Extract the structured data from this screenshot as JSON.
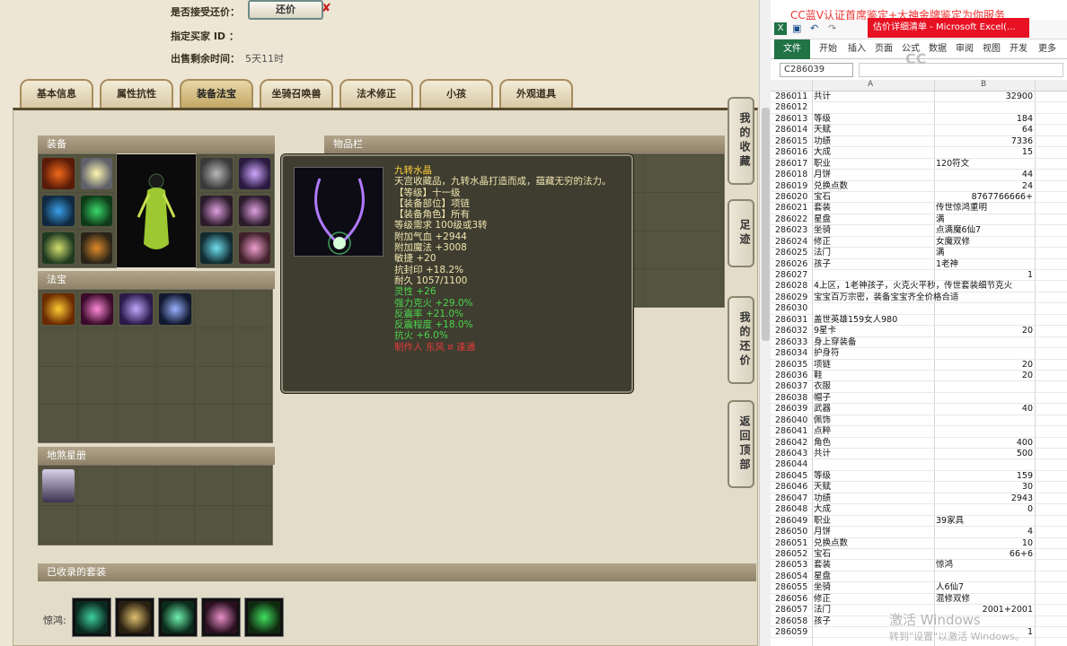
{
  "header": {
    "accept_counter_label": "是否接受还价：",
    "counter_button": "还价",
    "buyer_label": "指定买家 ID ：",
    "buyer_value": "",
    "time_label": "出售剩余时间：",
    "time_value": "5天11时"
  },
  "tabs": [
    "基本信息",
    "属性抗性",
    "装备法宝",
    "坐骑召唤兽",
    "法术修正",
    "小孩",
    "外观道具"
  ],
  "active_tab": "装备法宝",
  "sections": {
    "equipment": "装备",
    "inventory": "物品栏",
    "treasure": "法宝",
    "star_map": "地煞星册",
    "collected_sets": "已收录的套装"
  },
  "set_label": "惊鸿:",
  "tooltip": {
    "name": "九转水晶",
    "desc": "天宫收藏品，九转水晶打造而成，蕴藏无穷的法力。",
    "lines": [
      {
        "text": "【等级】十一级",
        "color": "#f0e6b0"
      },
      {
        "text": "【装备部位】项链",
        "color": "#f0e6b0"
      },
      {
        "text": "【装备角色】所有",
        "color": "#f0e6b0"
      },
      {
        "text": "等级需求 100级或3转",
        "color": "#f0e6b0"
      },
      {
        "text": "附加气血 +2944",
        "color": "#f0e6b0"
      },
      {
        "text": "附加魔法 +3008",
        "color": "#f0e6b0"
      },
      {
        "text": "敏捷 +20",
        "color": "#f0e6b0"
      },
      {
        "text": "抗封印 +18.2%",
        "color": "#f0e6b0"
      },
      {
        "text": "耐久 1057/1100",
        "color": "#f0e6b0"
      },
      {
        "text": "灵性 +26",
        "color": "#4cd64c"
      },
      {
        "text": "强力克火 +29.0%",
        "color": "#4cd64c"
      },
      {
        "text": "反震率 +21.0%",
        "color": "#4cd64c"
      },
      {
        "text": "反震程度 +18.0%",
        "color": "#4cd64c"
      },
      {
        "text": "抗火 +6.0%",
        "color": "#4cd64c"
      },
      {
        "text": "制作人 东风 ¤ 逢通",
        "color": "#e23a3a"
      }
    ]
  },
  "side_buttons": [
    "我的收藏",
    "足迹",
    "我的还价",
    "返回顶部"
  ],
  "excel": {
    "ad_text": "CC蓝V认证首席鉴定+大神金牌鉴定为你服务",
    "window_title": "估价详细清单 - Microsoft Excel(...",
    "ribbon_tabs": [
      "文件",
      "开始",
      "插入",
      "页面",
      "公式",
      "数据",
      "审阅",
      "视图",
      "开发",
      "更多"
    ],
    "name_box": "C286039",
    "col_a": "A",
    "col_b": "B",
    "watermark": "激活 Windows",
    "watermark_sub": "转到\"设置\"以激活 Windows。",
    "rows": [
      [
        "286011",
        "共计",
        "32900"
      ],
      [
        "286012",
        "",
        ""
      ],
      [
        "286013",
        "等级",
        "184"
      ],
      [
        "286014",
        "天赋",
        "64"
      ],
      [
        "286015",
        "功绩",
        "7336"
      ],
      [
        "286016",
        "大成",
        "15"
      ],
      [
        "286017",
        "职业",
        "120符文"
      ],
      [
        "286018",
        "月饼",
        "44"
      ],
      [
        "286019",
        "兑换点数",
        "24"
      ],
      [
        "286020",
        "宝石",
        "8767766666+"
      ],
      [
        "286021",
        "套装",
        "传世惊鸿重明"
      ],
      [
        "286022",
        "星盘",
        "满"
      ],
      [
        "286023",
        "坐骑",
        "点满魔6仙7"
      ],
      [
        "286024",
        "修正",
        "女魔双修"
      ],
      [
        "286025",
        "法门",
        "满"
      ],
      [
        "286026",
        "孩子",
        "1老神"
      ],
      [
        "286027",
        "",
        "1"
      ],
      [
        "286028",
        "4上区，1老神孩子，火克火平秒，传世套装细节克火",
        ""
      ],
      [
        "286029",
        "宝宝百万宗密，装备宝宝齐全价格合适",
        ""
      ],
      [
        "286030",
        "",
        ""
      ],
      [
        "286031",
        "盖世英雄159女人980",
        ""
      ],
      [
        "286032",
        "9星卡",
        "20"
      ],
      [
        "286033",
        "身上穿装备",
        ""
      ],
      [
        "286034",
        "护身符",
        ""
      ],
      [
        "286035",
        "项链",
        "20"
      ],
      [
        "286036",
        "鞋",
        "20"
      ],
      [
        "286037",
        "衣服",
        ""
      ],
      [
        "286038",
        "帽子",
        ""
      ],
      [
        "286039",
        "武器",
        "40"
      ],
      [
        "286040",
        "佩饰",
        ""
      ],
      [
        "286041",
        "点粹",
        ""
      ],
      [
        "286042",
        "角色",
        "400"
      ],
      [
        "286043",
        "共计",
        "500"
      ],
      [
        "286044",
        "",
        ""
      ],
      [
        "286045",
        "等级",
        "159"
      ],
      [
        "286046",
        "天赋",
        "30"
      ],
      [
        "286047",
        "功绩",
        "2943"
      ],
      [
        "286048",
        "大成",
        "0"
      ],
      [
        "286049",
        "职业",
        "39家具"
      ],
      [
        "286050",
        "月饼",
        "4"
      ],
      [
        "286051",
        "兑换点数",
        "10"
      ],
      [
        "286052",
        "宝石",
        "66+6"
      ],
      [
        "286053",
        "套装",
        "惊鸿"
      ],
      [
        "286054",
        "星盘",
        ""
      ],
      [
        "286055",
        "坐骑",
        "人6仙7"
      ],
      [
        "286056",
        "修正",
        "混修双修"
      ],
      [
        "286057",
        "法门",
        "2001+2001"
      ],
      [
        "286058",
        "孩子",
        ""
      ],
      [
        "286059",
        "",
        "1"
      ]
    ]
  }
}
